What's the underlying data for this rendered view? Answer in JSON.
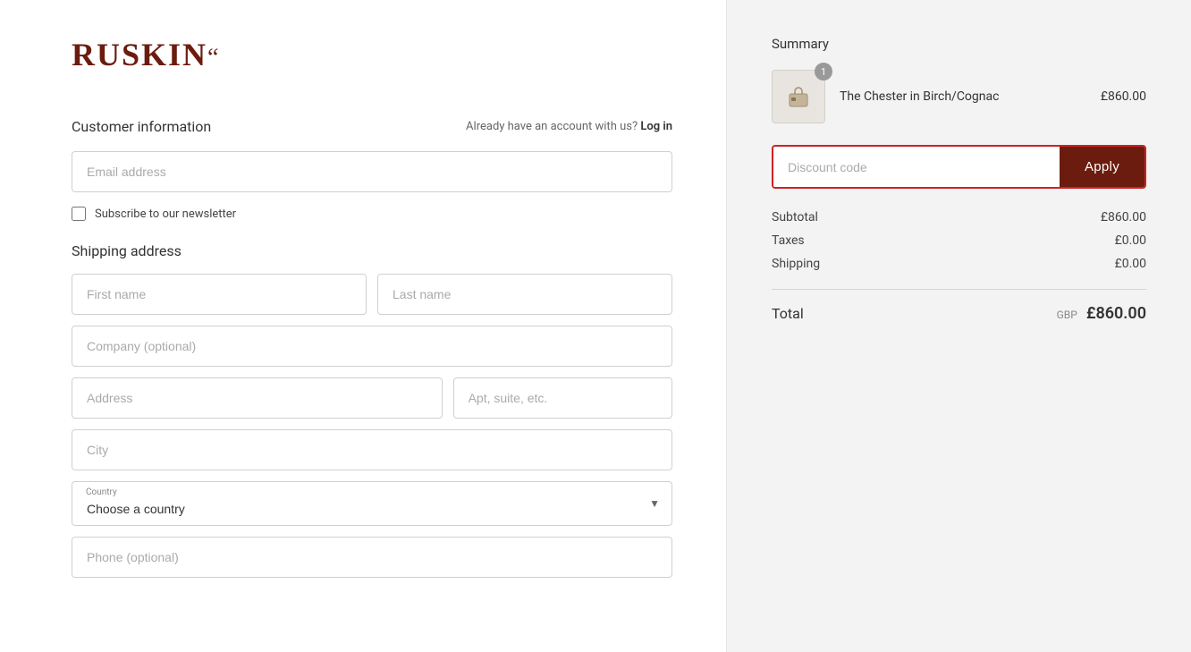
{
  "brand": {
    "name": "RUSKIN",
    "suffix": "ꞏꞏ"
  },
  "customer_info": {
    "section_title": "Customer information",
    "already_account_text": "Already have an account with us?",
    "login_text": "Log in",
    "email_placeholder": "Email address",
    "newsletter_label": "Subscribe to our newsletter"
  },
  "shipping": {
    "section_title": "Shipping address",
    "first_name_placeholder": "First name",
    "last_name_placeholder": "Last name",
    "company_placeholder": "Company (optional)",
    "address_placeholder": "Address",
    "apt_placeholder": "Apt, suite, etc.",
    "city_placeholder": "City",
    "country_label": "Country",
    "country_placeholder": "Choose a country",
    "phone_placeholder": "Phone (optional)"
  },
  "summary": {
    "title": "Summary",
    "product_name": "The Chester in Birch/Cognac",
    "product_price": "£860.00",
    "product_quantity": "1",
    "discount_placeholder": "Discount code",
    "apply_label": "Apply",
    "subtotal_label": "Subtotal",
    "subtotal_value": "£860.00",
    "taxes_label": "Taxes",
    "taxes_value": "£0.00",
    "shipping_label": "Shipping",
    "shipping_value": "£0.00",
    "total_label": "Total",
    "total_currency": "GBP",
    "total_value": "£860.00"
  },
  "colors": {
    "accent": "#6b1c0e",
    "border_highlight": "#cc2222",
    "text_dark": "#333333",
    "text_muted": "#888888"
  }
}
